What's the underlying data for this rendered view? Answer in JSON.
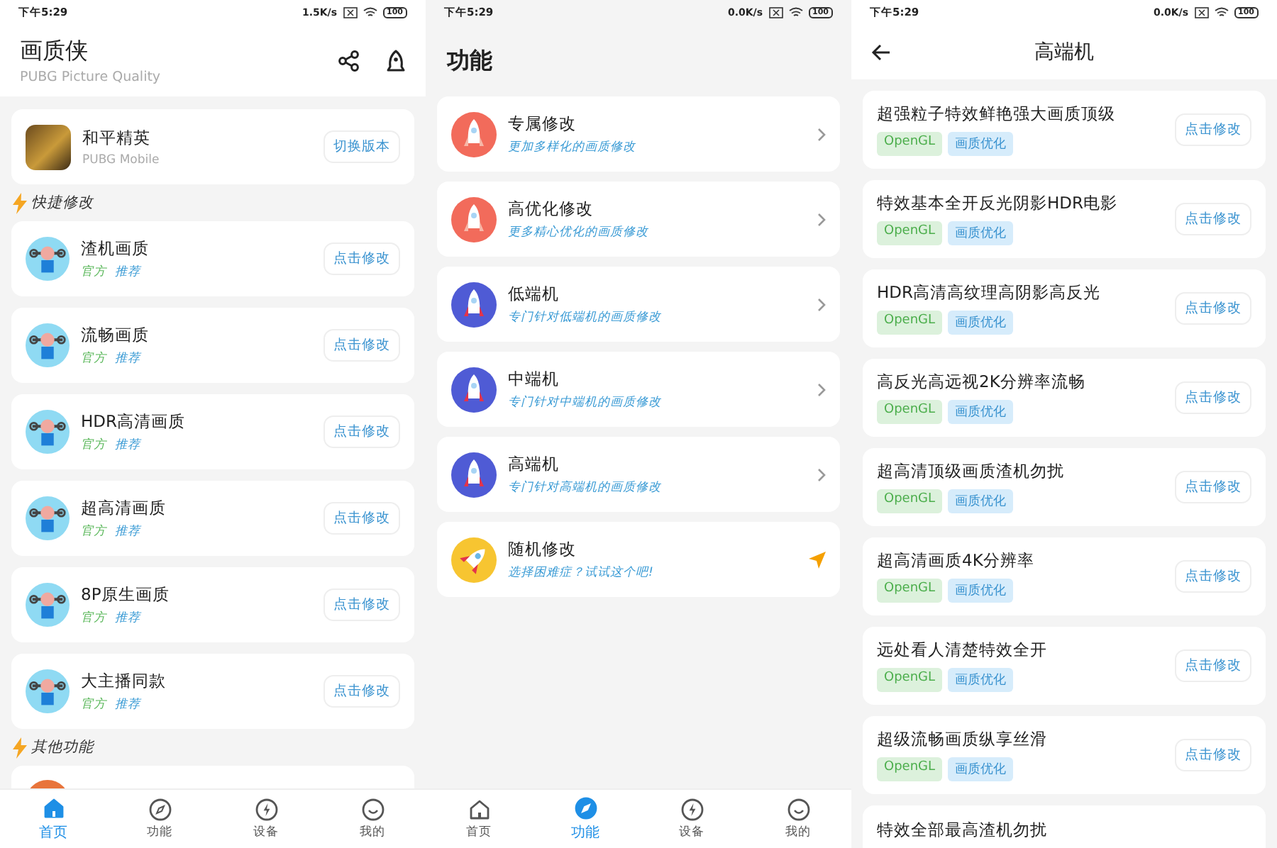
{
  "home": {
    "status_bar": {
      "time": "下午5:29",
      "speed": "1.5K/s",
      "battery": "100"
    },
    "header": {
      "title": "画质侠",
      "subtitle": "PUBG Picture Quality"
    },
    "game": {
      "name": "和平精英",
      "subtitle": "PUBG Mobile",
      "button": "切换版本"
    },
    "quick_title": "快捷修改",
    "presets": [
      {
        "name": "渣机画质",
        "official": "官方",
        "recommend": "推荐",
        "button": "点击修改"
      },
      {
        "name": "流畅画质",
        "official": "官方",
        "recommend": "推荐",
        "button": "点击修改"
      },
      {
        "name": "HDR高清画质",
        "official": "官方",
        "recommend": "推荐",
        "button": "点击修改"
      },
      {
        "name": "超高清画质",
        "official": "官方",
        "recommend": "推荐",
        "button": "点击修改"
      },
      {
        "name": "8P原生画质",
        "official": "官方",
        "recommend": "推荐",
        "button": "点击修改"
      },
      {
        "name": "大主播同款",
        "official": "官方",
        "recommend": "推荐",
        "button": "点击修改"
      }
    ],
    "other_title": "其他功能",
    "nav": [
      {
        "label": "首页",
        "selected": true
      },
      {
        "label": "功能",
        "selected": false
      },
      {
        "label": "设备",
        "selected": false
      },
      {
        "label": "我的",
        "selected": false
      }
    ]
  },
  "features": {
    "status_bar": {
      "time": "下午5:29",
      "speed": "0.0K/s",
      "battery": "100"
    },
    "title": "功能",
    "items": [
      {
        "name": "专属修改",
        "description": "更加多样化的画质修改",
        "kind": "special"
      },
      {
        "name": "高优化修改",
        "description": "更多精心优化的画质修改",
        "kind": "special"
      },
      {
        "name": "低端机",
        "description": "专门针对低端机的画质修改",
        "kind": "device"
      },
      {
        "name": "中端机",
        "description": "专门针对中端机的画质修改",
        "kind": "device"
      },
      {
        "name": "高端机",
        "description": "专门针对高端机的画质修改",
        "kind": "device"
      },
      {
        "name": "随机修改",
        "description": "选择困难症？试试这个吧!",
        "kind": "random"
      }
    ],
    "nav": [
      {
        "label": "首页",
        "selected": false
      },
      {
        "label": "功能",
        "selected": true
      },
      {
        "label": "设备",
        "selected": false
      },
      {
        "label": "我的",
        "selected": false
      }
    ]
  },
  "high_end": {
    "status_bar": {
      "time": "下午5:29",
      "speed": "0.0K/s",
      "battery": "100"
    },
    "title": "高端机",
    "configs": [
      {
        "name": "超强粒子特效鲜艳强大画质顶级",
        "tags": [
          {
            "text": "OpenGL",
            "kind": "api"
          },
          {
            "text": "画质优化",
            "kind": "quality"
          }
        ],
        "button": "点击修改"
      },
      {
        "name": "特效基本全开反光阴影HDR电影",
        "tags": [
          {
            "text": "OpenGL",
            "kind": "api"
          },
          {
            "text": "画质优化",
            "kind": "quality"
          }
        ],
        "button": "点击修改"
      },
      {
        "name": "HDR高清高纹理高阴影高反光",
        "tags": [
          {
            "text": "OpenGL",
            "kind": "api"
          },
          {
            "text": "画质优化",
            "kind": "quality"
          }
        ],
        "button": "点击修改"
      },
      {
        "name": "高反光高远视2K分辨率流畅",
        "tags": [
          {
            "text": "OpenGL",
            "kind": "api"
          },
          {
            "text": "画质优化",
            "kind": "quality"
          }
        ],
        "button": "点击修改"
      },
      {
        "name": "超高清顶级画质渣机勿扰",
        "tags": [
          {
            "text": "OpenGL",
            "kind": "api"
          },
          {
            "text": "画质优化",
            "kind": "quality"
          }
        ],
        "button": "点击修改"
      },
      {
        "name": "超高清画质4K分辨率",
        "tags": [
          {
            "text": "OpenGL",
            "kind": "api"
          },
          {
            "text": "画质优化",
            "kind": "quality"
          }
        ],
        "button": "点击修改"
      },
      {
        "name": "远处看人清楚特效全开",
        "tags": [
          {
            "text": "OpenGL",
            "kind": "api"
          },
          {
            "text": "画质优化",
            "kind": "quality"
          }
        ],
        "button": "点击修改"
      },
      {
        "name": "超级流畅画质纵享丝滑",
        "tags": [
          {
            "text": "OpenGL",
            "kind": "api"
          },
          {
            "text": "画质优化",
            "kind": "quality"
          }
        ],
        "button": "点击修改"
      },
      {
        "name": "特效全部最高渣机勿扰"
      }
    ]
  }
}
